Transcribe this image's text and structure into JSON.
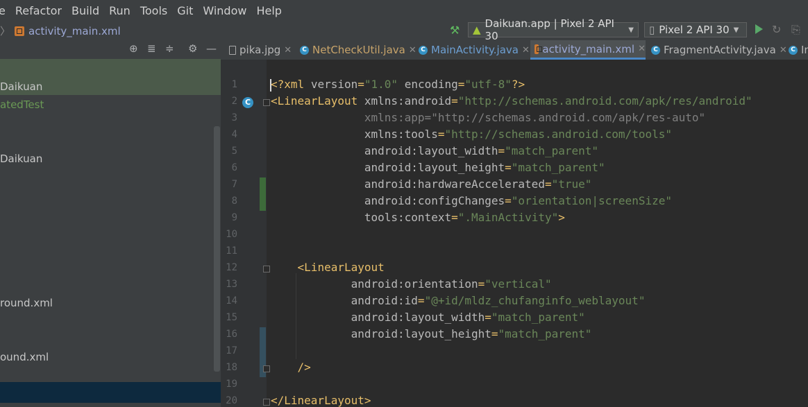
{
  "menu": [
    "e",
    "Refactor",
    "Build",
    "Run",
    "Tools",
    "Git",
    "Window",
    "Help"
  ],
  "breadcrumb": {
    "chevron": "〉",
    "file": "activity_main.xml"
  },
  "run_config": {
    "app": "Daikuan.app | Pixel 2 API 30",
    "device": "Pixel 2 API 30"
  },
  "sidebar": {
    "items": [
      {
        "label": "Daikuan",
        "color": "#c8c8c8"
      },
      {
        "label": "atedTest",
        "color": "#6a9955"
      },
      {
        "label": "Daikuan",
        "color": "#c8c8c8"
      },
      {
        "label": "round.xml",
        "color": "#c8c8c8"
      },
      {
        "label": "ound.xml",
        "color": "#c8c8c8"
      }
    ]
  },
  "tabs": [
    {
      "label": "pika.jpg",
      "icon": "image-icon"
    },
    {
      "label": "NetCheckUtil.java",
      "icon": "class-icon"
    },
    {
      "label": "MainActivity.java",
      "icon": "class-icon"
    },
    {
      "label": "activity_main.xml",
      "icon": "xml-icon",
      "active": true
    },
    {
      "label": "FragmentActivity.java",
      "icon": "class-icon"
    },
    {
      "label": "In",
      "icon": "class-icon"
    }
  ],
  "editor": {
    "line_numbers": [
      "1",
      "2",
      "3",
      "4",
      "5",
      "6",
      "7",
      "8",
      "9",
      "10",
      "11",
      "12",
      "13",
      "14",
      "15",
      "16",
      "17",
      "18",
      "19",
      "20"
    ],
    "lines": [
      "<?xml version=\"1.0\" encoding=\"utf-8\"?>",
      "<LinearLayout xmlns:android=\"http://schemas.android.com/apk/res/android\"",
      "              xmlns:app=\"http://schemas.android.com/apk/res-auto\"",
      "              xmlns:tools=\"http://schemas.android.com/tools\"",
      "              android:layout_width=\"match_parent\"",
      "              android:layout_height=\"match_parent\"",
      "              android:hardwareAccelerated=\"true\"",
      "              android:configChanges=\"orientation|screenSize\"",
      "              tools:context=\".MainActivity\">",
      "",
      "",
      "    <LinearLayout",
      "            android:orientation=\"vertical\"",
      "            android:id=\"@+id/mldz_chufanginfo_weblayout\"",
      "            android:layout_width=\"match_parent\"",
      "            android:layout_height=\"match_parent\"",
      "",
      "    />",
      "",
      "</LinearLayout>"
    ]
  },
  "colors": {
    "accent": "#4a88c7",
    "string": "#6a8759",
    "tag": "#e8bf6a",
    "build": "#5fb85f"
  }
}
